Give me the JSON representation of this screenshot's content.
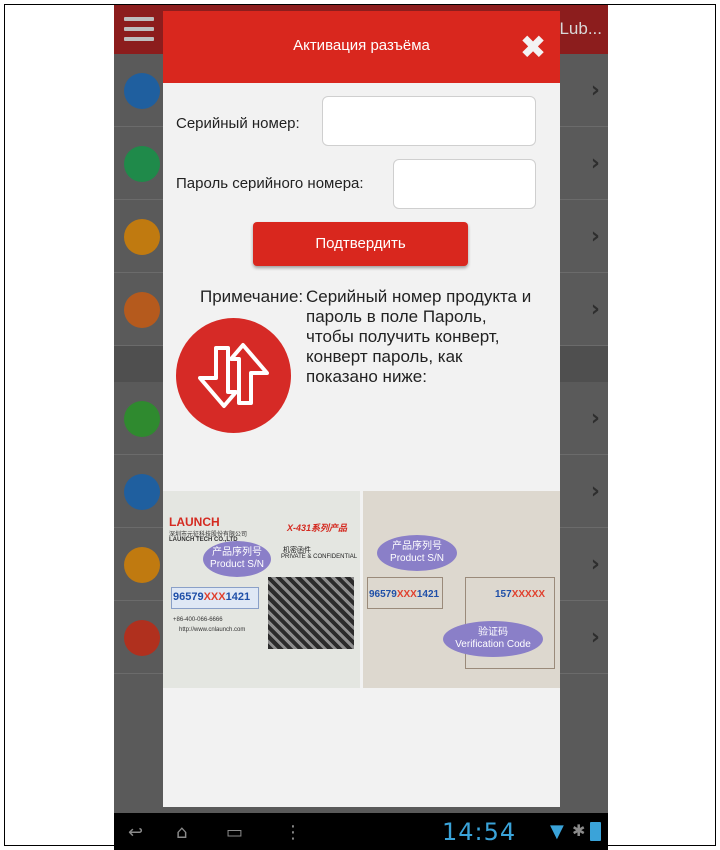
{
  "app": {
    "title_truncated": "Lub...",
    "menu_icon": "hamburger-menu-icon"
  },
  "list_rows": [
    {
      "icon": "chart-icon",
      "color": "#1f5f9f"
    },
    {
      "icon": "share-icon",
      "color": "#1f8a4a"
    },
    {
      "icon": "folder-star-icon",
      "color": "#c07a10"
    },
    {
      "icon": "globe-icon",
      "color": "#b55a1d"
    },
    {
      "icon": "gauge-icon",
      "color": "#2f8a2f"
    },
    {
      "icon": "id-card-icon",
      "color": "#1f5f9f"
    },
    {
      "icon": "printer-icon",
      "color": "#c07a10"
    },
    {
      "icon": "settings-icon",
      "color": "#b0301e"
    }
  ],
  "dialog": {
    "title": "Активация разъёма",
    "serial_label": "Серийный номер:",
    "serial_value": "",
    "password_label": "Пароль серийного номера:",
    "password_value": "",
    "confirm_label": "Подтвердить",
    "note_title": "Примечание:",
    "note_text": "Серийный номер продукта и пароль в поле Пароль, чтобы получить конверт, конверт пароль, как показано ниже:",
    "accent_color": "#d9271e"
  },
  "photo_left": {
    "brand": "LAUNCH",
    "brand_sub": "深圳市元征科技股份有限公司",
    "company": "LAUNCH TECH CO.,LTD",
    "product_badge": "X-431系列产品",
    "envelope_cn": "机密函件",
    "envelope_en": "PRIVATE & CONFIDENTIAL",
    "bubble_cn": "产品序列号",
    "bubble_en": "Product S/N",
    "serial_prefix": "96579",
    "serial_masked": "XXX",
    "serial_suffix": "1421",
    "phone": "+86-400-066-6666",
    "website": "http://www.cnlaunch.com"
  },
  "photo_right": {
    "bubble_cn": "产品序列号",
    "bubble_en": "Product S/N",
    "serial_prefix": "96579",
    "serial_masked": "XXX",
    "serial_suffix": "1421",
    "code_prefix": "157",
    "code_masked": "XXXXX",
    "code_bubble_cn": "验证码",
    "code_bubble_en": "Verification Code"
  },
  "status_bar": {
    "time": "14:54",
    "back_icon": "back-icon",
    "home_icon": "home-icon",
    "recents_icon": "recents-icon",
    "menu_icon": "overflow-menu-icon"
  }
}
